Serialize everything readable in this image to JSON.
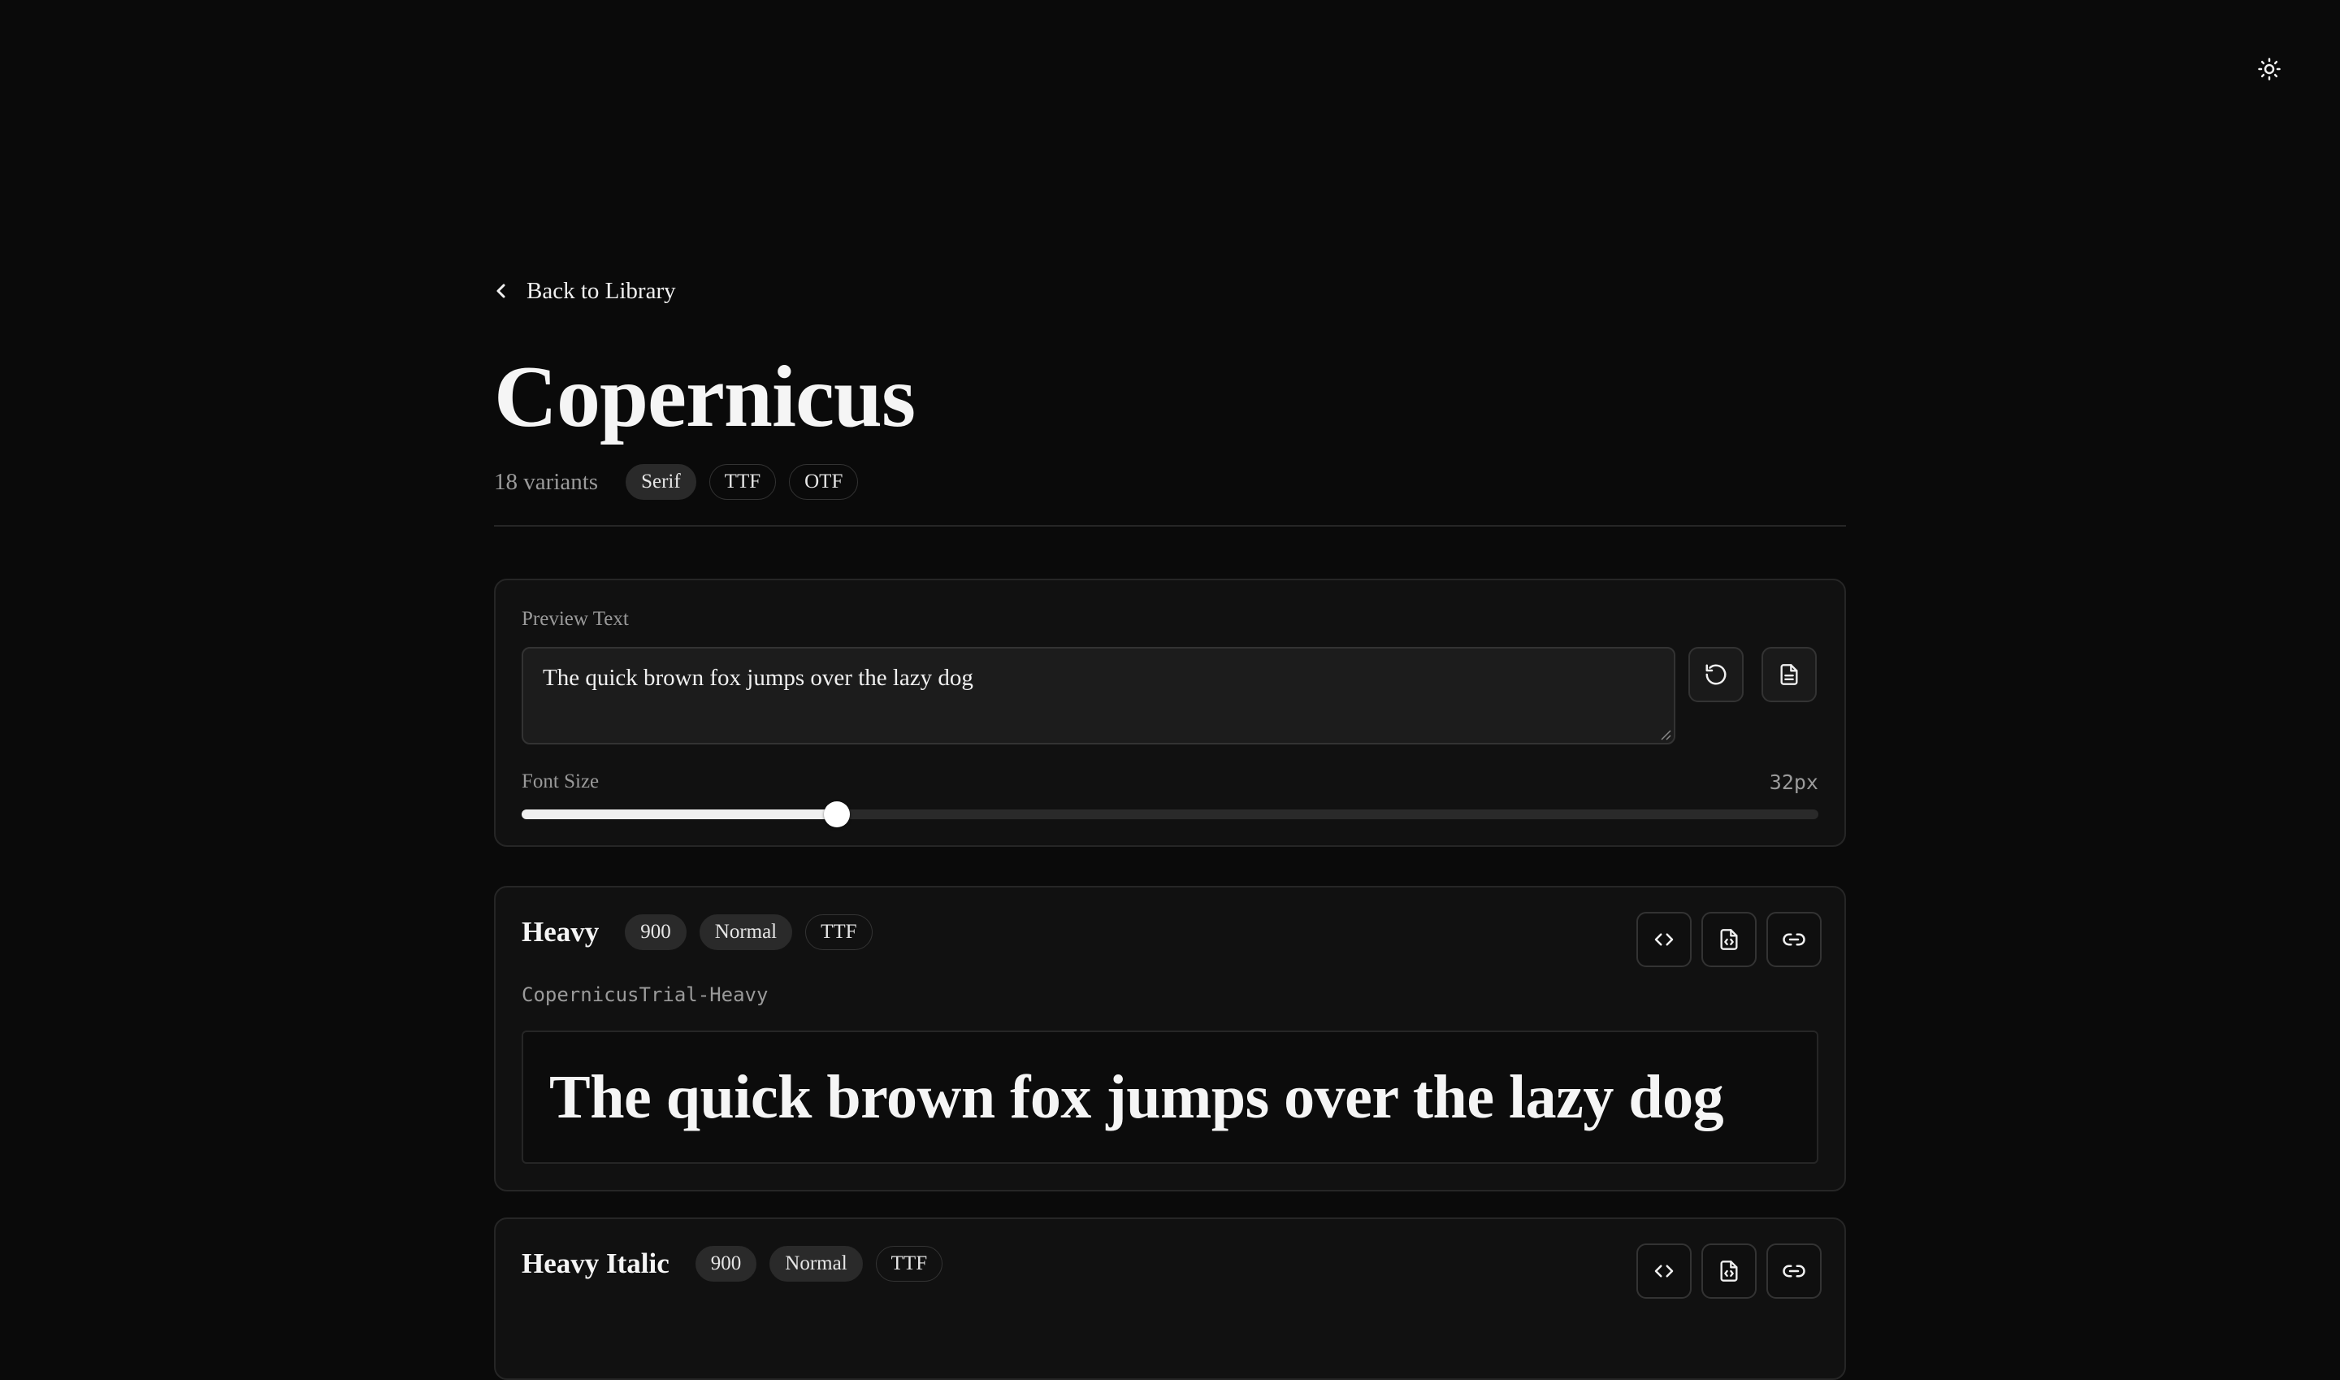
{
  "header": {
    "theme_toggle_icon": "sun-icon"
  },
  "nav": {
    "back_icon": "chevron-left-icon",
    "back_label": "Back to Library"
  },
  "font": {
    "family_name": "Copernicus",
    "variant_count": "18 variants",
    "tags": [
      "Serif",
      "TTF",
      "OTF"
    ]
  },
  "preview": {
    "label": "Preview Text",
    "text": "The quick brown fox jumps over the lazy dog",
    "reset_icon": "reset-icon",
    "sample_text_icon": "document-icon",
    "font_size_label": "Font Size",
    "font_size_value": "32px",
    "font_size_level_fraction": 0.243
  },
  "variants": [
    {
      "name": "Heavy",
      "weight": "900",
      "style": "Normal",
      "format": "TTF",
      "postscript_name": "CopernicusTrial-Heavy",
      "sample": "The quick brown fox jumps over the lazy dog",
      "actions": [
        "code-icon",
        "file-code-icon",
        "link-icon"
      ]
    },
    {
      "name": "Heavy Italic",
      "weight": "900",
      "style": "Normal",
      "format": "TTF",
      "actions": [
        "code-icon",
        "file-code-icon",
        "link-icon"
      ]
    }
  ],
  "colors": {
    "background": "#0a0a0a",
    "card": "#111111",
    "border": "#262626",
    "text": "#ededed",
    "muted": "#9a9a9a"
  }
}
